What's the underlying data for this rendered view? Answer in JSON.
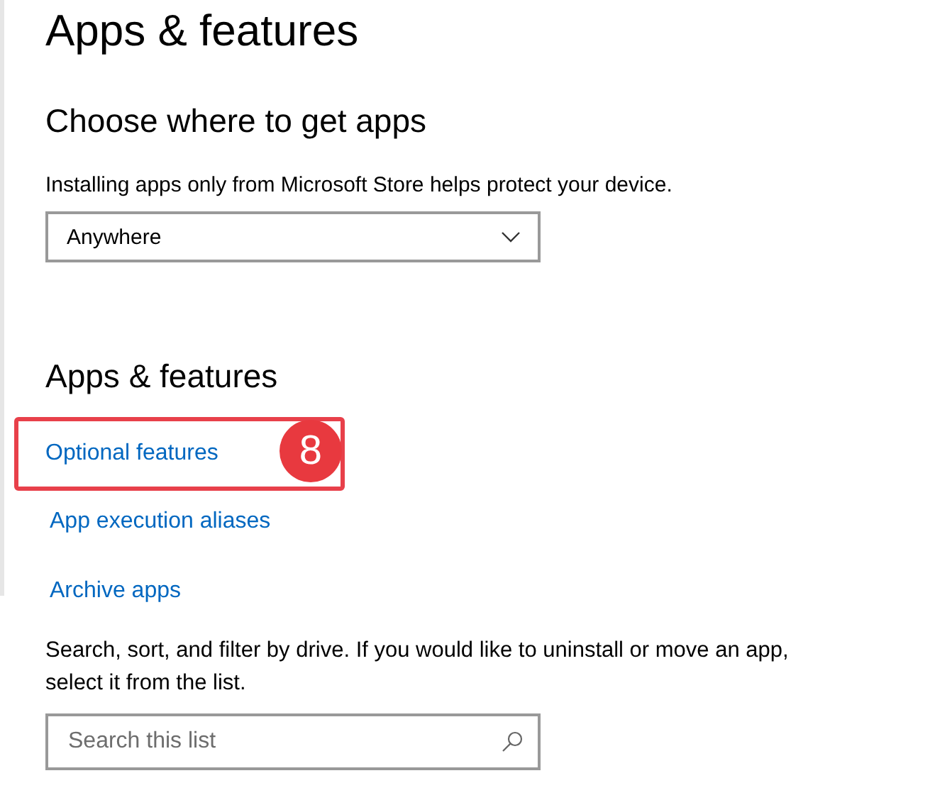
{
  "title": "Apps & features",
  "source_section": {
    "heading": "Choose where to get apps",
    "description": "Installing apps only from Microsoft Store helps protect your device.",
    "dropdown": {
      "value": "Anywhere"
    }
  },
  "features_section": {
    "heading": "Apps & features",
    "links": [
      {
        "label": "Optional features",
        "highlighted": true,
        "callout": "8"
      },
      {
        "label": "App execution aliases",
        "highlighted": false
      },
      {
        "label": "Archive apps",
        "highlighted": false
      }
    ],
    "description": "Search, sort, and filter by drive. If you would like to uninstall or move an app, select it from the list.",
    "search": {
      "placeholder": "Search this list"
    }
  }
}
